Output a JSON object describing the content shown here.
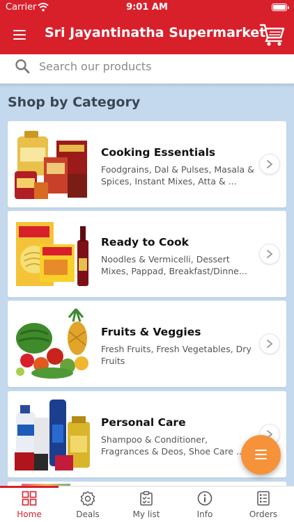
{
  "status_bar": {
    "carrier": "Carrier",
    "time": "9:01 AM"
  },
  "header": {
    "title": "Sri Jayantinatha Supermarket"
  },
  "search": {
    "placeholder": "Search our products"
  },
  "section": {
    "title": "Shop by Category"
  },
  "categories": [
    {
      "title": "Cooking Essentials",
      "description": "Foodgrains, Dal & Pulses, Masala & Spices, Instant Mixes, Atta & ..."
    },
    {
      "title": "Ready to Cook",
      "description": "Noodles & Vermicelli, Dessert Mixes, Pappad, Breakfast/Dinne..."
    },
    {
      "title": "Fruits & Veggies",
      "description": "Fresh Fruits, Fresh Vegetables, Dry Fruits"
    },
    {
      "title": "Personal Care",
      "description": "Shampoo & Conditioner, Fragrances & Deos, Shoe Care ..."
    }
  ],
  "tabs": [
    {
      "label": "Home",
      "icon": "grid-icon",
      "active": true
    },
    {
      "label": "Deals",
      "icon": "badge-icon",
      "active": false
    },
    {
      "label": "My list",
      "icon": "clipboard-icon",
      "active": false
    },
    {
      "label": "Info",
      "icon": "info-icon",
      "active": false
    },
    {
      "label": "Orders",
      "icon": "orders-icon",
      "active": false
    }
  ],
  "colors": {
    "brand_red": "#d8202b",
    "fab_orange": "#f6923a",
    "background": "#c5d9ee"
  }
}
